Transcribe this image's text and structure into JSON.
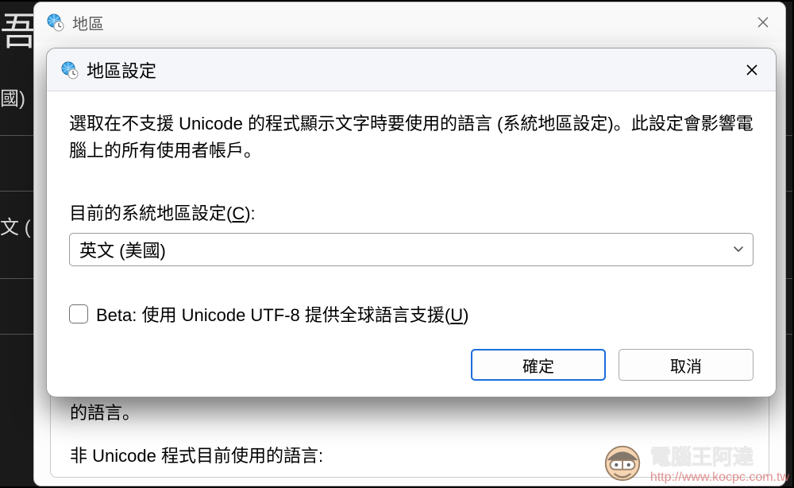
{
  "backdrop": {
    "big_title_partial": "吾言",
    "left_partial_1": "國)",
    "left_partial_2": "文 ("
  },
  "parent_window": {
    "title": "地區",
    "body_line1": "的語言。",
    "body_line2": "非 Unicode 程式目前使用的語言:"
  },
  "dialog": {
    "title": "地區設定",
    "description": "選取在不支援 Unicode 的程式顯示文字時要使用的語言 (系統地區設定)。此設定會影響電腦上的所有使用者帳戶。",
    "field_label_prefix": "目前的系統地區設定(",
    "field_label_shortcut": "C",
    "field_label_suffix": "):",
    "selected_locale": "英文 (美國)",
    "checkbox_prefix": "Beta: 使用 Unicode UTF-8 提供全球語言支援(",
    "checkbox_shortcut": "U",
    "checkbox_suffix": ")",
    "ok_label": "確定",
    "cancel_label": "取消"
  },
  "watermark": {
    "name": "電腦王阿達",
    "url": "http://www.kocpc.com.tw"
  }
}
